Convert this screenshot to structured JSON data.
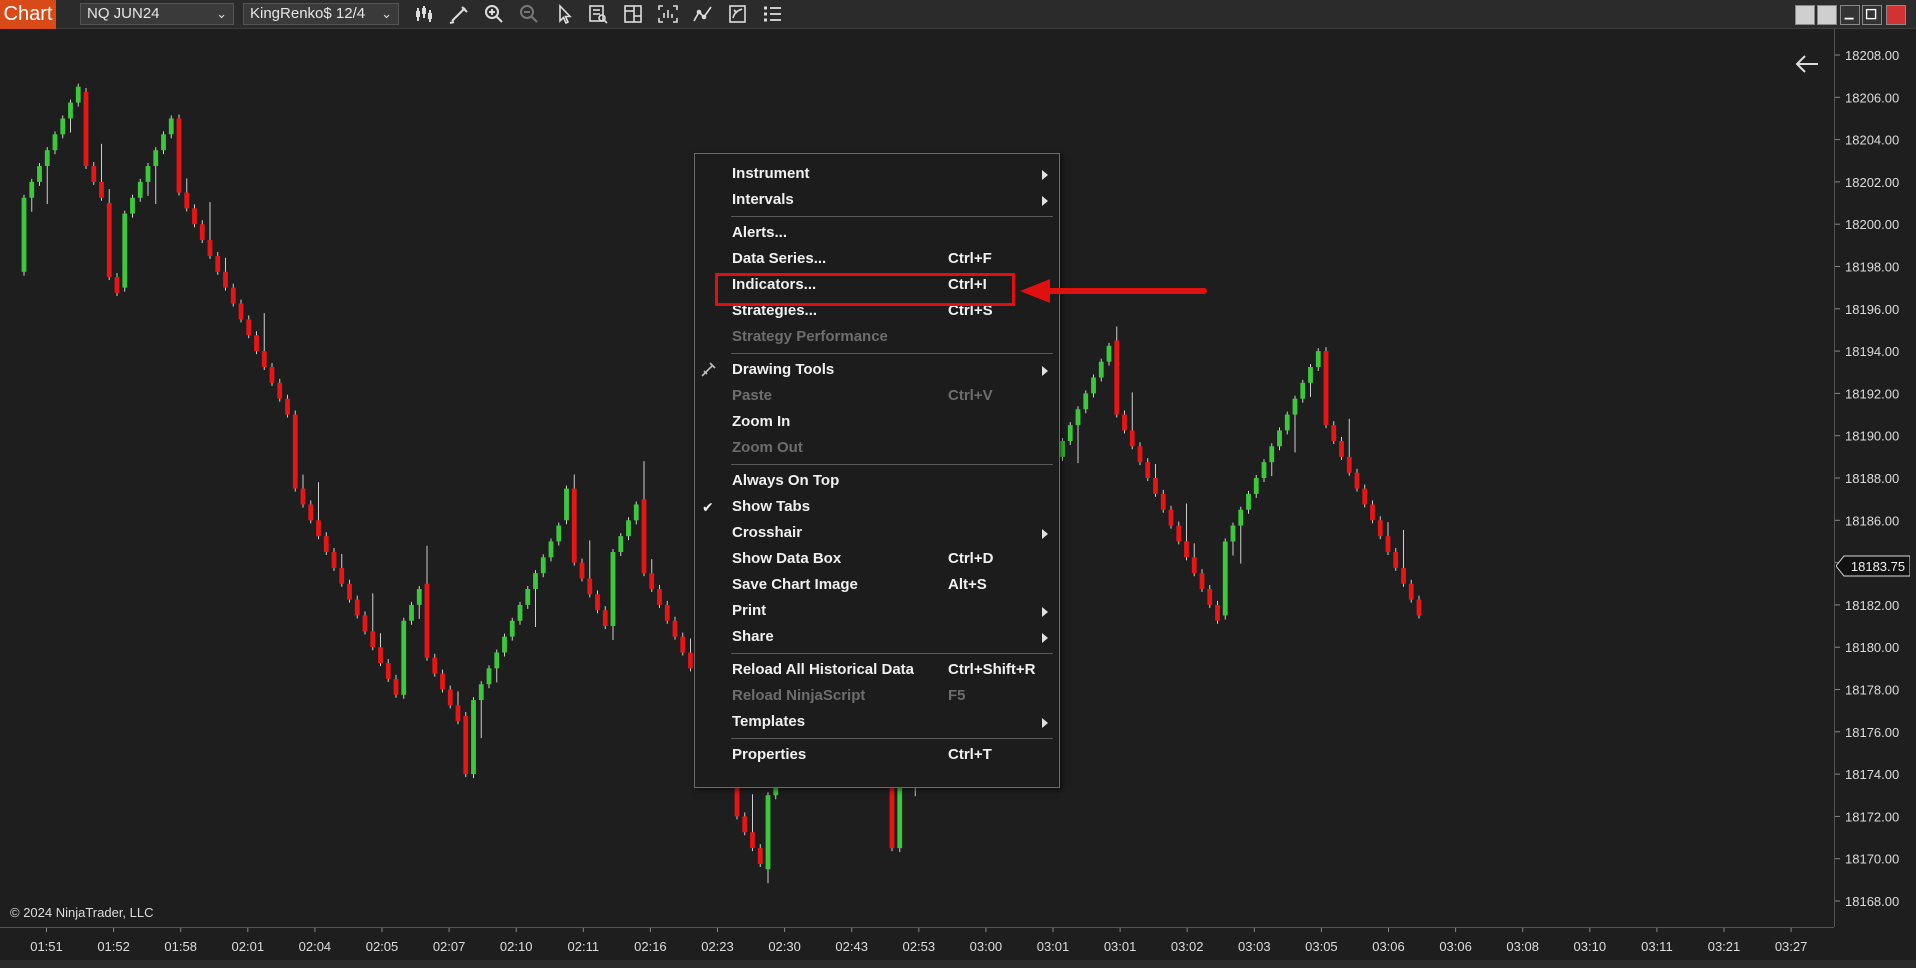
{
  "toolbar": {
    "app_tab": "Chart",
    "instrument": "NQ JUN24",
    "interval": "KingRenko$ 12/4",
    "icons": [
      "bar-type-icon",
      "pencil-draw-icon",
      "zoom-in-icon",
      "zoom-out-icon",
      "pointer-icon",
      "data-box-icon",
      "chart-properties-icon",
      "screenshot-icon",
      "strategy-icon",
      "indicator-icon",
      "list-icon"
    ],
    "window_buttons": [
      "tile-left-icon",
      "tile-right-icon",
      "minimize-icon",
      "maximize-icon",
      "close-icon"
    ]
  },
  "chart": {
    "copyright": "© 2024 NinjaTrader, LLC",
    "current_price": "18183.75",
    "y_labels": [
      "18208.00",
      "18206.00",
      "18204.00",
      "18202.00",
      "18200.00",
      "18198.00",
      "18196.00",
      "18194.00",
      "18192.00",
      "18190.00",
      "18188.00",
      "18186.00",
      "18184.00",
      "18182.00",
      "18180.00",
      "18178.00",
      "18176.00",
      "18174.00",
      "18172.00",
      "18170.00",
      "18168.00"
    ],
    "x_labels": [
      "01:51",
      "01:52",
      "01:58",
      "02:01",
      "02:04",
      "02:05",
      "02:07",
      "02:10",
      "02:11",
      "02:16",
      "02:23",
      "02:30",
      "02:43",
      "02:53",
      "03:00",
      "03:01",
      "03:01",
      "03:02",
      "03:03",
      "03:05",
      "03:06",
      "03:06",
      "03:08",
      "03:10",
      "03:11",
      "03:21",
      "03:27"
    ],
    "colors": {
      "up": "#3cc83c",
      "down": "#e81515",
      "wick": "#cfcfcf",
      "background": "#1e1e1e"
    }
  },
  "chart_data": {
    "type": "candlestick",
    "ylim": [
      18167,
      18209
    ],
    "x_ticks": [
      "01:51",
      "01:52",
      "01:58",
      "02:01",
      "02:04",
      "02:05",
      "02:07",
      "02:10",
      "02:11",
      "02:16",
      "02:23",
      "02:30",
      "02:43",
      "02:53",
      "03:00",
      "03:01",
      "03:01",
      "03:02",
      "03:03",
      "03:05",
      "03:06",
      "03:06",
      "03:08",
      "03:10",
      "03:11",
      "03:21",
      "03:27"
    ],
    "waypoints": [
      [
        18197.75,
        "up"
      ],
      [
        18206.25,
        "up"
      ],
      [
        18201.0,
        "down"
      ],
      [
        18197.0,
        "down"
      ],
      [
        18205.0,
        "up"
      ],
      [
        18191.0,
        "down"
      ],
      [
        18177.75,
        "down"
      ],
      [
        18183.0,
        "up"
      ],
      [
        18176.75,
        "down"
      ],
      [
        18174.0,
        "down"
      ],
      [
        18186.0,
        "up"
      ],
      [
        18187.5,
        "up"
      ],
      [
        18181.0,
        "down"
      ],
      [
        18187.0,
        "up"
      ],
      [
        18175.5,
        "down"
      ],
      [
        18169.5,
        "down"
      ],
      [
        18180.5,
        "up"
      ],
      [
        18174.0,
        "down"
      ],
      [
        18170.5,
        "down"
      ],
      [
        18194.5,
        "up"
      ],
      [
        18181.5,
        "down"
      ],
      [
        18194.0,
        "up"
      ],
      [
        18181.5,
        "down"
      ]
    ],
    "current_price": 18183.75
  },
  "menu": {
    "items": [
      {
        "id": "instrument",
        "label": "Instrument",
        "sub": true
      },
      {
        "id": "intervals",
        "label": "Intervals",
        "sub": true
      },
      {
        "sep": true
      },
      {
        "id": "alerts",
        "label": "Alerts..."
      },
      {
        "id": "data-series",
        "label": "Data Series...",
        "shortcut": "Ctrl+F"
      },
      {
        "id": "indicators",
        "label": "Indicators...",
        "shortcut": "Ctrl+I"
      },
      {
        "id": "strategies",
        "label": "Strategies...",
        "shortcut": "Ctrl+S"
      },
      {
        "id": "strategy-performance",
        "label": "Strategy Performance",
        "disabled": true
      },
      {
        "sep": true
      },
      {
        "id": "drawing-tools",
        "label": "Drawing Tools",
        "sub": true,
        "icon": true
      },
      {
        "id": "paste",
        "label": "Paste",
        "shortcut": "Ctrl+V",
        "disabled": true
      },
      {
        "id": "zoom-in",
        "label": "Zoom In"
      },
      {
        "id": "zoom-out",
        "label": "Zoom Out",
        "disabled": true
      },
      {
        "sep": true
      },
      {
        "id": "always-on-top",
        "label": "Always On Top"
      },
      {
        "id": "show-tabs",
        "label": "Show Tabs",
        "checked": true
      },
      {
        "id": "crosshair",
        "label": "Crosshair",
        "sub": true
      },
      {
        "id": "show-data-box",
        "label": "Show Data Box",
        "shortcut": "Ctrl+D"
      },
      {
        "id": "save-chart-image",
        "label": "Save Chart Image",
        "shortcut": "Alt+S"
      },
      {
        "id": "print",
        "label": "Print",
        "sub": true
      },
      {
        "id": "share",
        "label": "Share",
        "sub": true
      },
      {
        "sep": true
      },
      {
        "id": "reload-all-historical-data",
        "label": "Reload All Historical Data",
        "shortcut": "Ctrl+Shift+R"
      },
      {
        "id": "reload-ninjascript",
        "label": "Reload NinjaScript",
        "shortcut": "F5",
        "disabled": true
      },
      {
        "id": "templates",
        "label": "Templates",
        "sub": true
      },
      {
        "sep": true
      },
      {
        "id": "properties",
        "label": "Properties",
        "shortcut": "Ctrl+T"
      }
    ]
  }
}
